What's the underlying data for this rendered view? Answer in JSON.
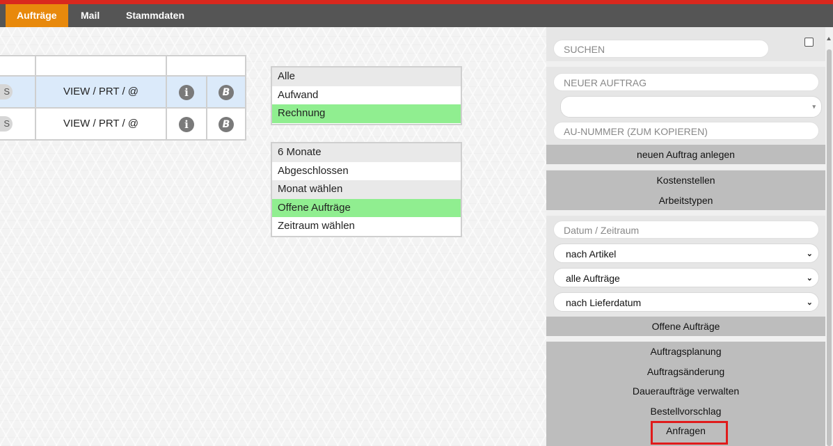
{
  "nav": {
    "tabs": [
      {
        "label": "Aufträge",
        "active": true
      },
      {
        "label": "Mail"
      },
      {
        "label": "Stammdaten"
      }
    ]
  },
  "table": {
    "rows": [
      {
        "stub": "S",
        "actions": "VIEW / PRT / @",
        "info_icon": "i",
        "b_icon": "B"
      },
      {
        "stub": "S",
        "actions": "VIEW / PRT / @",
        "info_icon": "i",
        "b_icon": "B"
      }
    ]
  },
  "filter_type": {
    "items": [
      "Alle",
      "Aufwand",
      "Rechnung"
    ],
    "selected": "Rechnung"
  },
  "filter_time": {
    "items": [
      "6 Monate",
      "Abgeschlossen",
      "Monat wählen",
      "Offene Aufträge",
      "Zeitraum wählen"
    ],
    "selected": "Offene Aufträge"
  },
  "panel": {
    "search_placeholder": "SUCHEN",
    "new_order_placeholder": "NEUER AUFTRAG",
    "au_number_placeholder": "AU-NUMMER (ZUM KOPIEREN)",
    "create_order": "neuen Auftrag anlegen",
    "kostenstellen": "Kostenstellen",
    "arbeitstypen": "Arbeitstypen",
    "date_placeholder": "Datum / Zeitraum",
    "select_artikel": "nach Artikel",
    "select_auftraege": "alle Aufträge",
    "select_lieferdatum": "nach Lieferdatum",
    "open_orders": "Offene Aufträge",
    "menu": [
      "Auftragsplanung",
      "Auftragsänderung",
      "Daueraufträge verwalten",
      "Bestellvorschlag",
      "Anfragen"
    ]
  },
  "colors": {
    "accent": "#e8890c",
    "nav_bg": "#555555",
    "top_line": "#d9281e",
    "green": "#90ee90",
    "highlight_row": "#dbeafa",
    "red_outline": "#e01b1b"
  }
}
